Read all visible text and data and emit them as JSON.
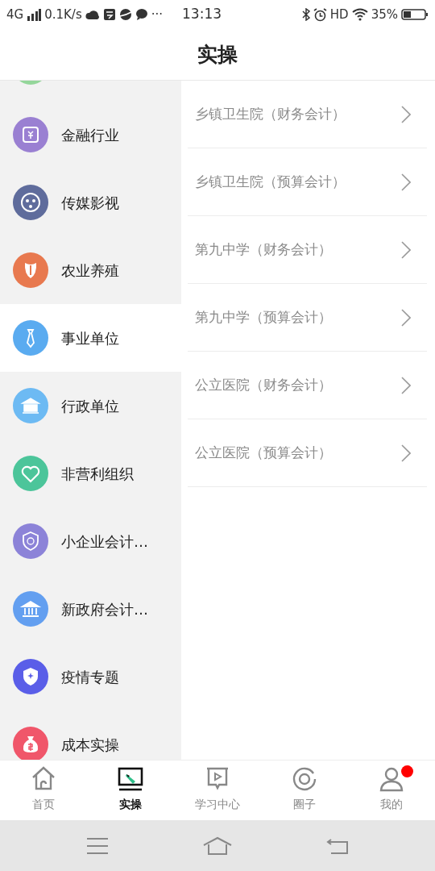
{
  "status_bar": {
    "network": "4G",
    "speed": "0.1K/s",
    "more": "···",
    "time": "13:13",
    "hd": "HD",
    "battery": "35%"
  },
  "header": {
    "title": "实操"
  },
  "sidebar": {
    "items": [
      {
        "color": "#94d69a",
        "selected": false
      },
      {
        "label": "金融行业",
        "color": "#9a80d2",
        "selected": false
      },
      {
        "label": "传媒影视",
        "color": "#5f6c9c",
        "selected": false
      },
      {
        "label": "农业养殖",
        "color": "#e8794f",
        "selected": false
      },
      {
        "label": "事业单位",
        "color": "#5aabf0",
        "selected": true
      },
      {
        "label": "行政单位",
        "color": "#6dbaf3",
        "selected": false
      },
      {
        "label": "非营利组织",
        "color": "#4cc59a",
        "selected": false
      },
      {
        "label": "小企业会计…",
        "color": "#8c83d8",
        "selected": false
      },
      {
        "label": "新政府会计…",
        "color": "#639ff0",
        "selected": false
      },
      {
        "label": "疫情专题",
        "color": "#5a5ee8",
        "selected": false
      },
      {
        "label": "成本实操",
        "color": "#f0566a",
        "selected": false
      }
    ]
  },
  "list": {
    "items": [
      {
        "label": "乡镇卫生院（财务会计）"
      },
      {
        "label": "乡镇卫生院（预算会计）"
      },
      {
        "label": "第九中学（财务会计）"
      },
      {
        "label": "第九中学（预算会计）"
      },
      {
        "label": "公立医院（财务会计）"
      },
      {
        "label": "公立医院（预算会计）"
      }
    ]
  },
  "tab_bar": {
    "tabs": [
      {
        "label": "首页",
        "selected": false,
        "badge": false
      },
      {
        "label": "实操",
        "selected": true,
        "badge": false
      },
      {
        "label": "学习中心",
        "selected": false,
        "badge": false
      },
      {
        "label": "圈子",
        "selected": false,
        "badge": false
      },
      {
        "label": "我的",
        "selected": false,
        "badge": true
      }
    ]
  }
}
